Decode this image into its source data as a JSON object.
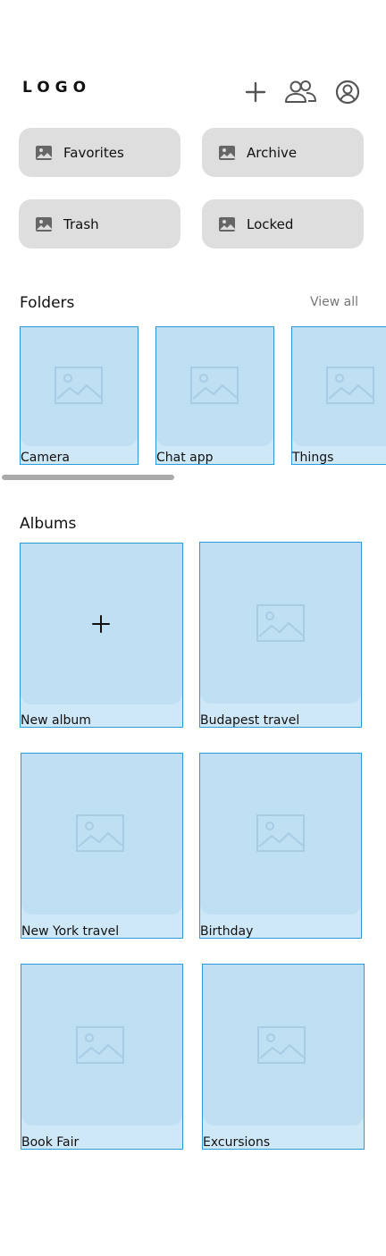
{
  "header": {
    "logo": "LOGO",
    "add_icon": "plus-icon",
    "people_icon": "people-icon",
    "profile_icon": "user-circle-icon"
  },
  "quick_access": [
    {
      "label": "Favorites",
      "icon": "image-icon"
    },
    {
      "label": "Archive",
      "icon": "image-icon"
    },
    {
      "label": "Trash",
      "icon": "image-icon"
    },
    {
      "label": "Locked",
      "icon": "image-icon"
    }
  ],
  "folders": {
    "title": "Folders",
    "view_all": "View all",
    "items": [
      {
        "label": "Camera"
      },
      {
        "label": "Chat app"
      },
      {
        "label": "Things"
      }
    ]
  },
  "albums": {
    "title": "Albums",
    "items": [
      {
        "label": "New album",
        "type": "add"
      },
      {
        "label": "Budapest travel"
      },
      {
        "label": "New York travel"
      },
      {
        "label": "Birthday"
      },
      {
        "label": "Book Fair"
      },
      {
        "label": "Excursions"
      }
    ]
  },
  "colors": {
    "accent_border": "#2a9bd9",
    "card_fill": "#cfe8f8",
    "thumb_fill": "#bfdff3",
    "chip_fill": "#dedede"
  }
}
